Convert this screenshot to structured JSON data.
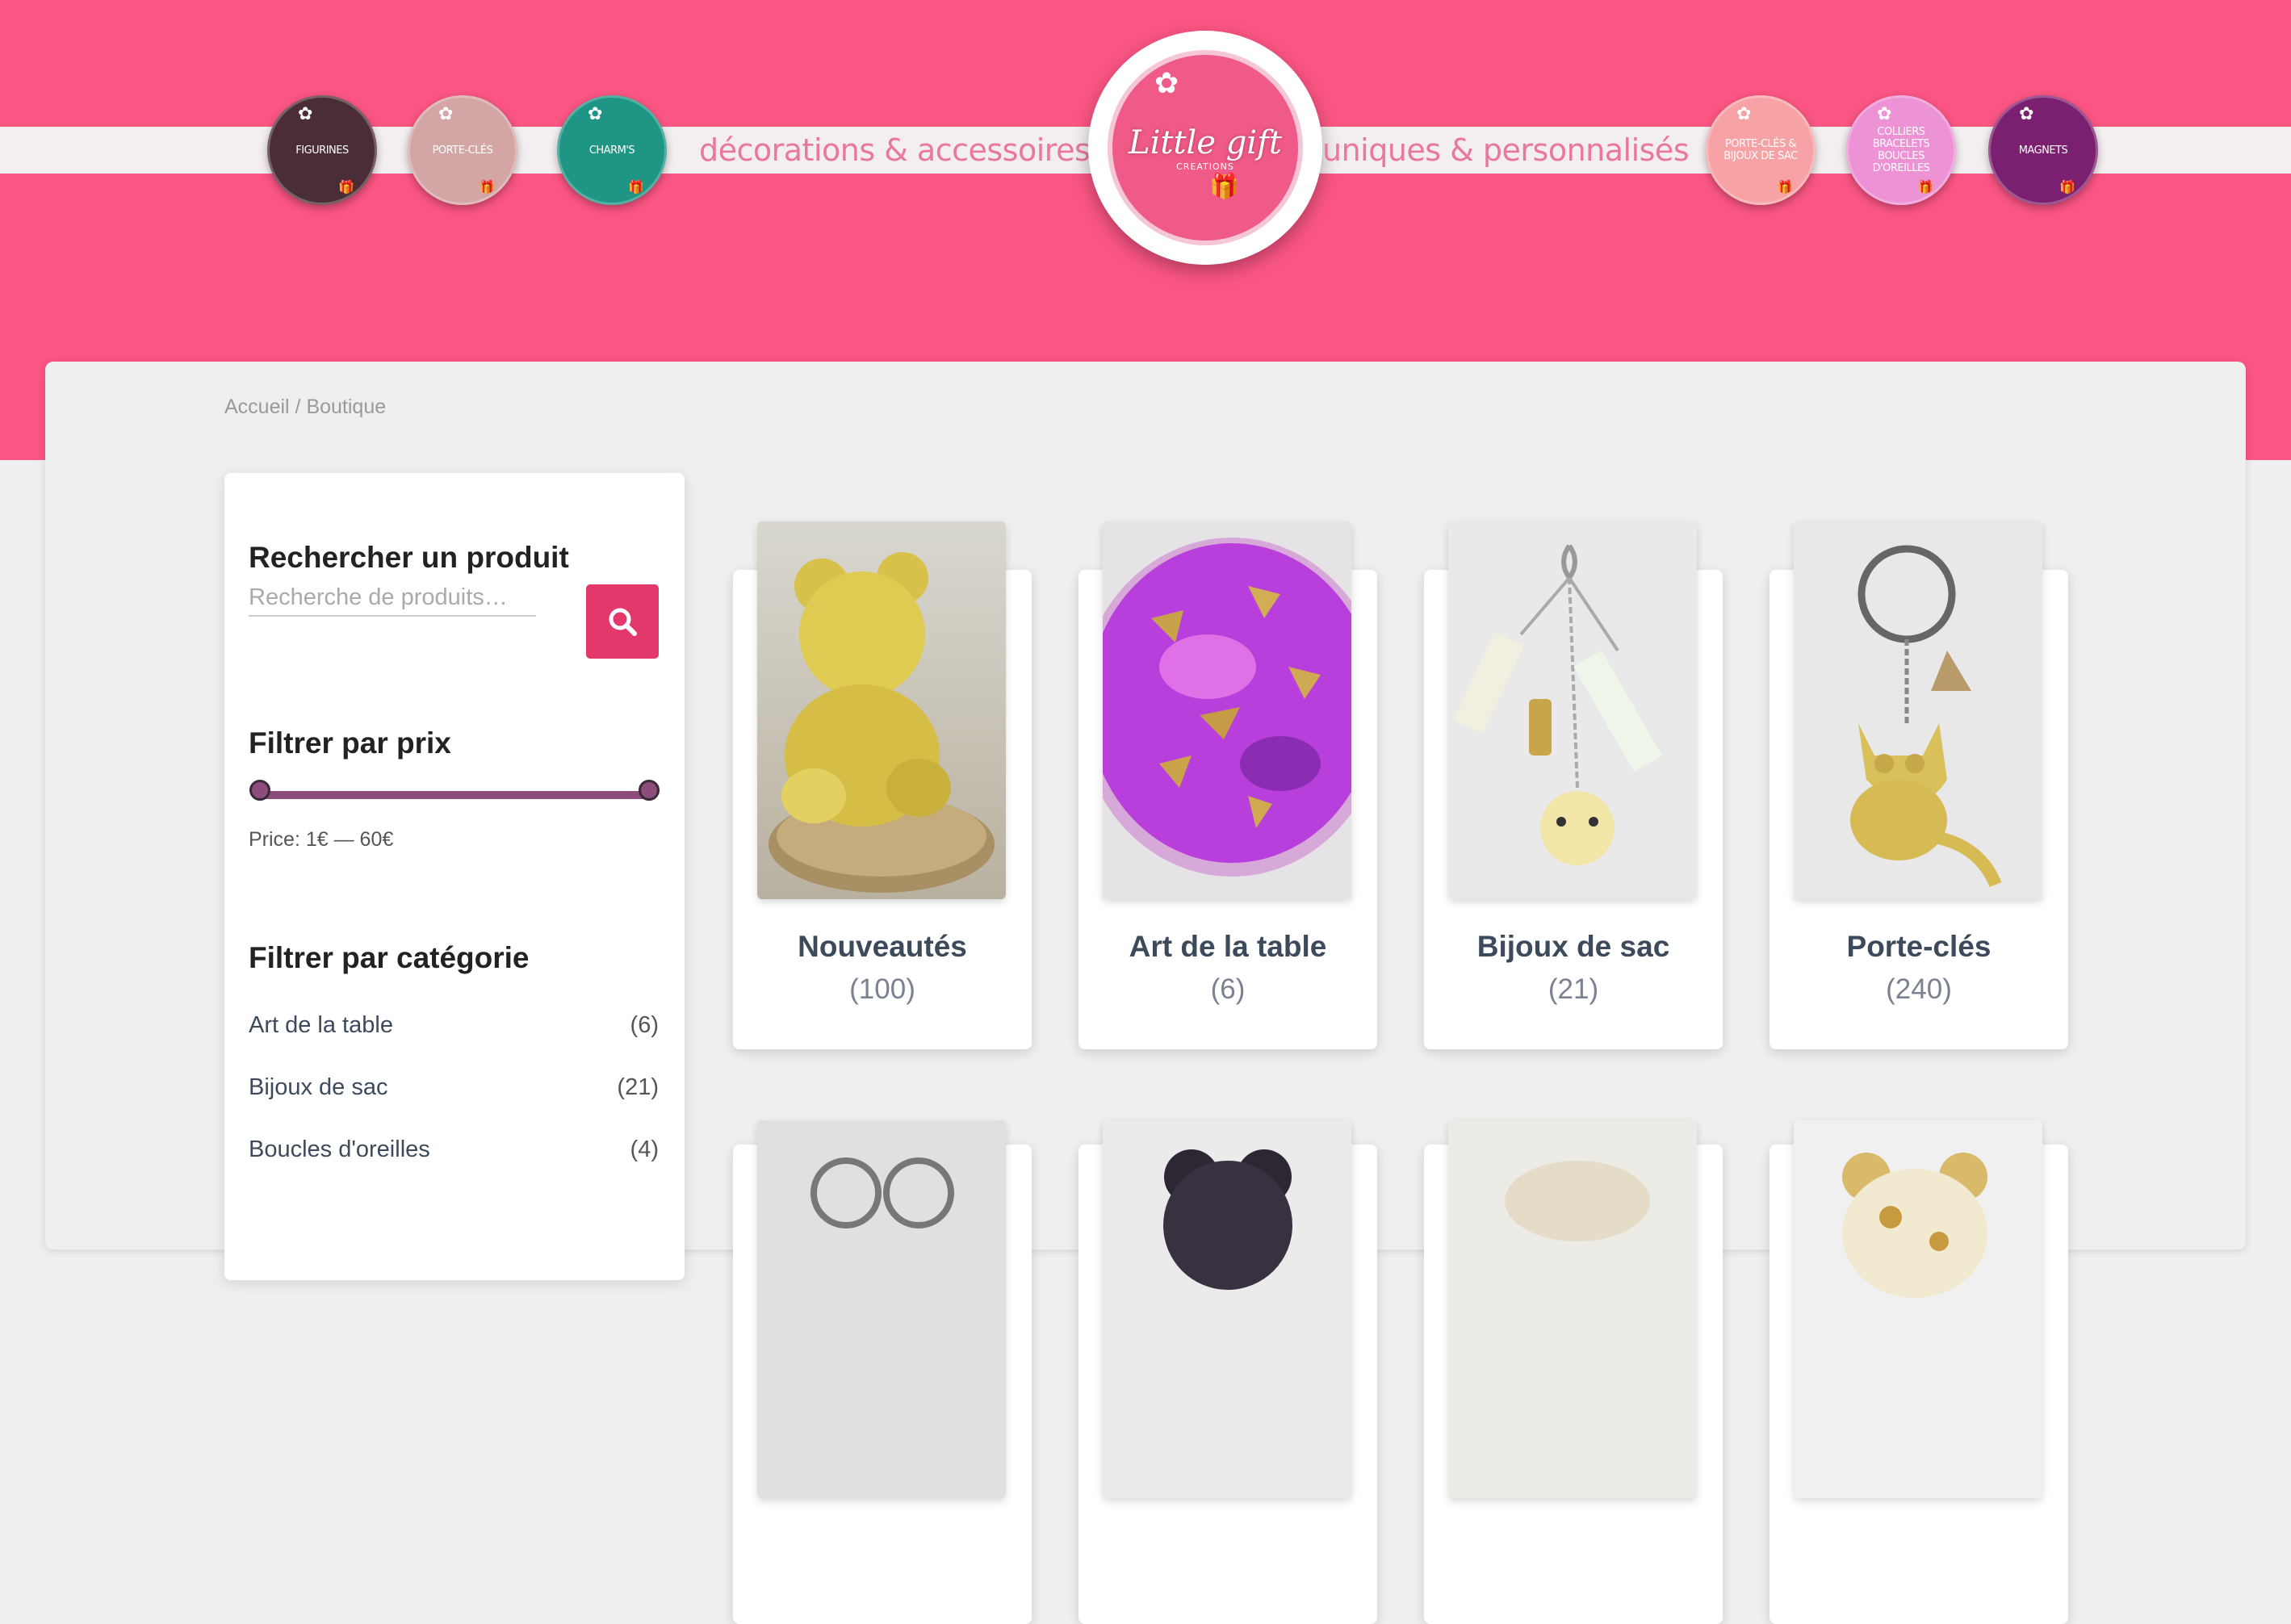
{
  "header": {
    "tagline_left": "décorations & accessoires",
    "tagline_right": "uniques & personnalisés",
    "logo_title": "Little gift",
    "logo_sub": "CREATIONS",
    "categories": [
      {
        "label": "FIGURINES",
        "color": "#4a2d36"
      },
      {
        "label": "PORTE-CLÉS",
        "color": "#d4a5a5"
      },
      {
        "label": "CHARM'S",
        "color": "#1e9585"
      },
      {
        "label": "PORTE-CLÉS & BIJOUX DE SAC",
        "color": "#f7a3a5"
      },
      {
        "label": "COLLIERS BRACELETS BOUCLES D'OREILLES",
        "color": "#ee92d6"
      },
      {
        "label": "MAGNETS",
        "color": "#7b1f70"
      }
    ]
  },
  "breadcrumb": {
    "home": "Accueil",
    "separator": " / ",
    "current": "Boutique"
  },
  "sidebar": {
    "search_title": "Rechercher un produit",
    "search_placeholder": "Recherche de produits…",
    "price_title": "Filtrer par prix",
    "price_text": "Price: 1€ — 60€",
    "category_title": "Filtrer par catégorie",
    "categories": [
      {
        "label": "Art de la table",
        "count": "(6)"
      },
      {
        "label": "Bijoux de sac",
        "count": "(21)"
      },
      {
        "label": "Boucles d'oreilles",
        "count": "(4)"
      }
    ]
  },
  "products": [
    {
      "name": "Nouveautés",
      "count": "(100)"
    },
    {
      "name": "Art de la table",
      "count": "(6)"
    },
    {
      "name": "Bijoux de sac",
      "count": "(21)"
    },
    {
      "name": "Porte-clés",
      "count": "(240)"
    }
  ],
  "colors": {
    "header_pink": "#fa5583",
    "accent": "#e3386b",
    "slider": "#8c4c7c"
  }
}
